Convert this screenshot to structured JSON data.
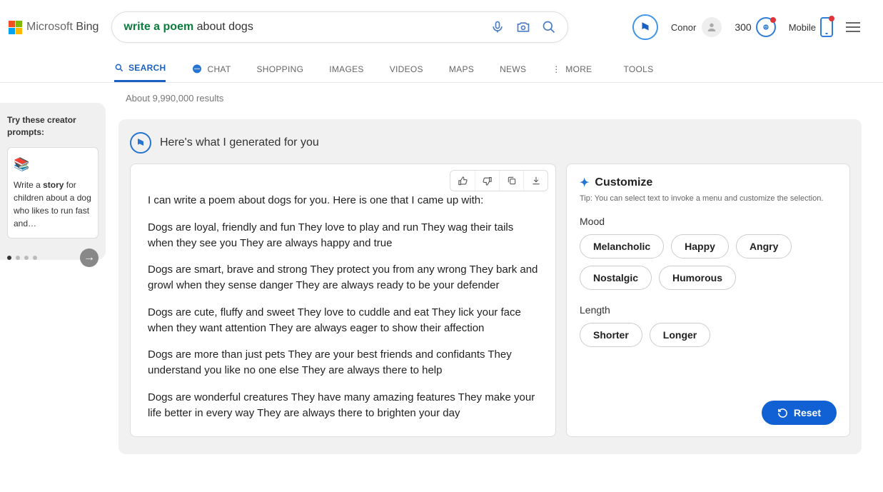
{
  "logo": {
    "brand": "Microsoft",
    "product": "Bing"
  },
  "search": {
    "query_highlight": "write a poem",
    "query_rest": " about dogs"
  },
  "header": {
    "username": "Conor",
    "points": "300",
    "mobile_label": "Mobile"
  },
  "nav": {
    "items": [
      "SEARCH",
      "CHAT",
      "SHOPPING",
      "IMAGES",
      "VIDEOS",
      "MAPS",
      "NEWS",
      "MORE",
      "TOOLS"
    ]
  },
  "results_count": "About 9,990,000 results",
  "sidebar": {
    "title": "Try these creator prompts:",
    "card_prefix": "Write a ",
    "card_bold": "story",
    "card_suffix": " for children about a dog who likes to run fast and…"
  },
  "ai": {
    "header": "Here's what I generated for you",
    "intro": "I can write a poem about dogs for you. Here is one that I came up with:",
    "stanzas": [
      "Dogs are loyal, friendly and fun They love to play and run They wag their tails when they see you They are always happy and true",
      "Dogs are smart, brave and strong They protect you from any wrong They bark and growl when they sense danger They are always ready to be your defender",
      "Dogs are cute, fluffy and sweet They love to cuddle and eat They lick your face when they want attention They are always eager to show their affection",
      "Dogs are more than just pets They are your best friends and confidants They understand you like no one else They are always there to help",
      "Dogs are wonderful creatures They have many amazing features They make your life better in every way They are always there to brighten your day"
    ]
  },
  "customize": {
    "title": "Customize",
    "tip": "Tip: You can select text to invoke a menu and customize the selection.",
    "mood_label": "Mood",
    "moods": [
      "Melancholic",
      "Happy",
      "Angry",
      "Nostalgic",
      "Humorous"
    ],
    "length_label": "Length",
    "lengths": [
      "Shorter",
      "Longer"
    ],
    "reset": "Reset"
  }
}
